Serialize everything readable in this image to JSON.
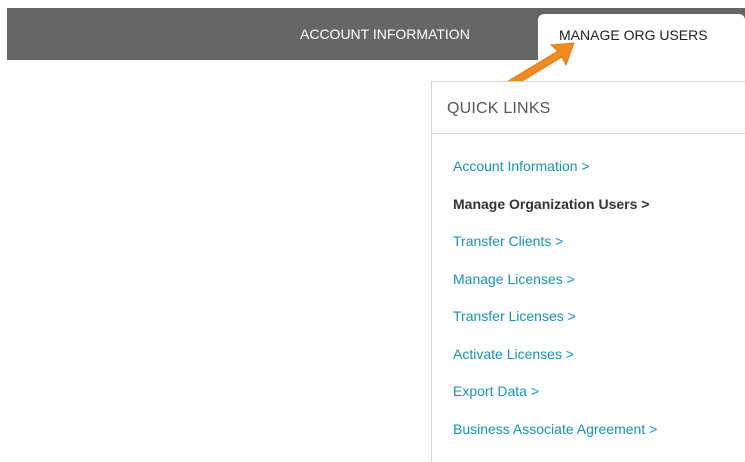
{
  "nav": {
    "tabs": [
      {
        "label": "ACCOUNT INFORMATION",
        "active": false
      },
      {
        "label": "MANAGE ORG USERS",
        "active": true
      }
    ]
  },
  "quick_links": {
    "title": "QUICK LINKS",
    "items": [
      {
        "label": "Account Information >",
        "active": false
      },
      {
        "label": "Manage Organization Users >",
        "active": true
      },
      {
        "label": "Transfer Clients >",
        "active": false
      },
      {
        "label": "Manage Licenses >",
        "active": false
      },
      {
        "label": "Transfer Licenses >",
        "active": false
      },
      {
        "label": "Activate Licenses >",
        "active": false
      },
      {
        "label": "Export Data >",
        "active": false
      },
      {
        "label": "Business Associate Agreement >",
        "active": false
      }
    ]
  },
  "colors": {
    "nav_bar": "#666666",
    "link": "#1a8fb5",
    "active_link": "#333333",
    "arrow": "#f08a24"
  },
  "annotation": {
    "icon": "arrow-icon"
  }
}
